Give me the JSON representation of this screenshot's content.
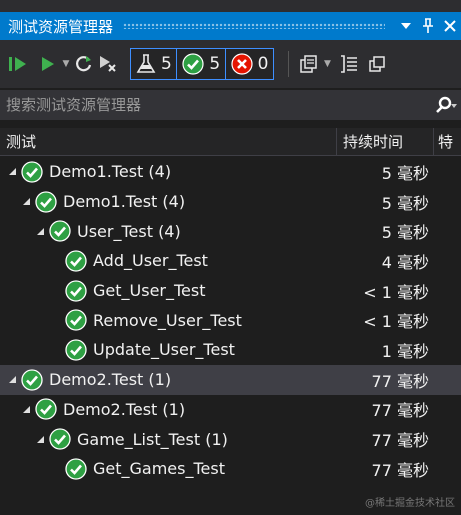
{
  "window": {
    "title": "测试资源管理器",
    "buttons": {
      "dropdown": "▾",
      "pin": "⊥",
      "close": "✕"
    }
  },
  "toolbar": {
    "counters": {
      "total": "5",
      "passed": "5",
      "failed": "0"
    },
    "icons": [
      "run-all-icon",
      "run-icon",
      "refresh-icon",
      "cancel-icon",
      "flask-icon",
      "pass-icon",
      "fail-icon",
      "playlist-icon",
      "group-by-icon",
      "settings-icon"
    ]
  },
  "search": {
    "placeholder": "搜索测试资源管理器"
  },
  "columns": {
    "test": "测试",
    "duration": "持续时间",
    "traits": "特"
  },
  "tree": [
    {
      "name": "Demo1.Test (4)",
      "duration": "5 毫秒",
      "level": 0
    },
    {
      "name": "Demo1.Test (4)",
      "duration": "5 毫秒",
      "level": 1
    },
    {
      "name": "User_Test (4)",
      "duration": "5 毫秒",
      "level": 2
    },
    {
      "name": "Add_User_Test",
      "duration": "4 毫秒",
      "level": 3
    },
    {
      "name": "Get_User_Test",
      "duration": "< 1 毫秒",
      "level": 3
    },
    {
      "name": "Remove_User_Test",
      "duration": "< 1 毫秒",
      "level": 3
    },
    {
      "name": "Update_User_Test",
      "duration": "1 毫秒",
      "level": 3
    },
    {
      "name": "Demo2.Test (1)",
      "duration": "77 毫秒",
      "level": 0,
      "selected": true
    },
    {
      "name": "Demo2.Test (1)",
      "duration": "77 毫秒",
      "level": 1
    },
    {
      "name": "Game_List_Test (1)",
      "duration": "77 毫秒",
      "level": 2
    },
    {
      "name": "Get_Games_Test",
      "duration": "77 毫秒",
      "level": 3
    }
  ],
  "watermark": "@稀土掘金技术社区",
  "colors": {
    "accent": "#007acc",
    "pass": "#2ea043",
    "fail": "#e51400",
    "background": "#1e1e1e"
  }
}
